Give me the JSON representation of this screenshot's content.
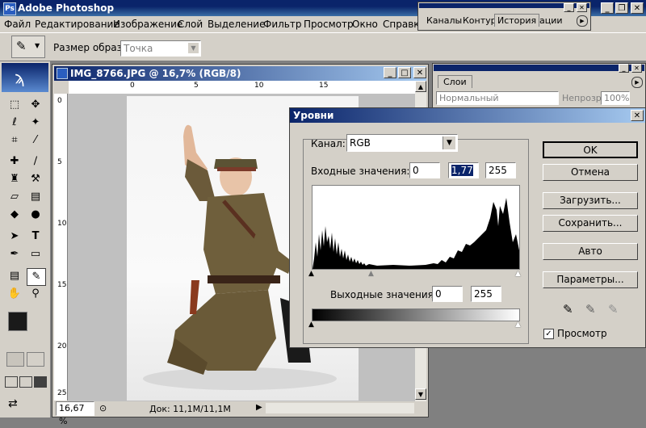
{
  "app": {
    "title": "Adobe Photoshop",
    "logo": "Ps",
    "window_buttons": [
      "_",
      "❐",
      "✕"
    ]
  },
  "menu": [
    "Файл",
    "Редактирование",
    "Изображение",
    "Слой",
    "Выделение",
    "Фильтр",
    "Просмотр",
    "Окно",
    "Справка"
  ],
  "options": {
    "sample_size_label": "Размер образца:",
    "sample_size_value": "Точка"
  },
  "history_palette": {
    "tabs": [
      "Каналы",
      "Контуры",
      "История",
      "ации"
    ],
    "active_tab": "История"
  },
  "layers_palette": {
    "tab": "Слои",
    "blend_mode": "Нормальный",
    "opacity_label": "Непрозр.:",
    "opacity_value": "100%"
  },
  "document": {
    "title": "IMG_8766.JPG @ 16,7% (RGB/8)",
    "zoom": "16,67 %",
    "doc_info": "Док: 11,1M/11,1M",
    "ruler_top_labels": [
      "0",
      "5",
      "10",
      "15"
    ],
    "ruler_left_labels": [
      "0",
      "5",
      "10",
      "15",
      "20",
      "25"
    ]
  },
  "levels": {
    "title": "Уровни",
    "channel_label": "Канал:",
    "channel_value": "RGB",
    "input_label": "Входные значения:",
    "input_black": "0",
    "input_gamma": "1,77",
    "input_white": "255",
    "output_label": "Выходные значения:",
    "output_black": "0",
    "output_white": "255",
    "buttons": {
      "ok": "OK",
      "cancel": "Отмена",
      "load": "Загрузить...",
      "save": "Сохранить...",
      "auto": "Авто",
      "options": "Параметры..."
    },
    "preview_label": "Просмотр",
    "preview_checked": true
  },
  "colors": {
    "title_bar": "#0a246a",
    "chrome": "#d4d0c8",
    "selection": "#0a246a"
  }
}
